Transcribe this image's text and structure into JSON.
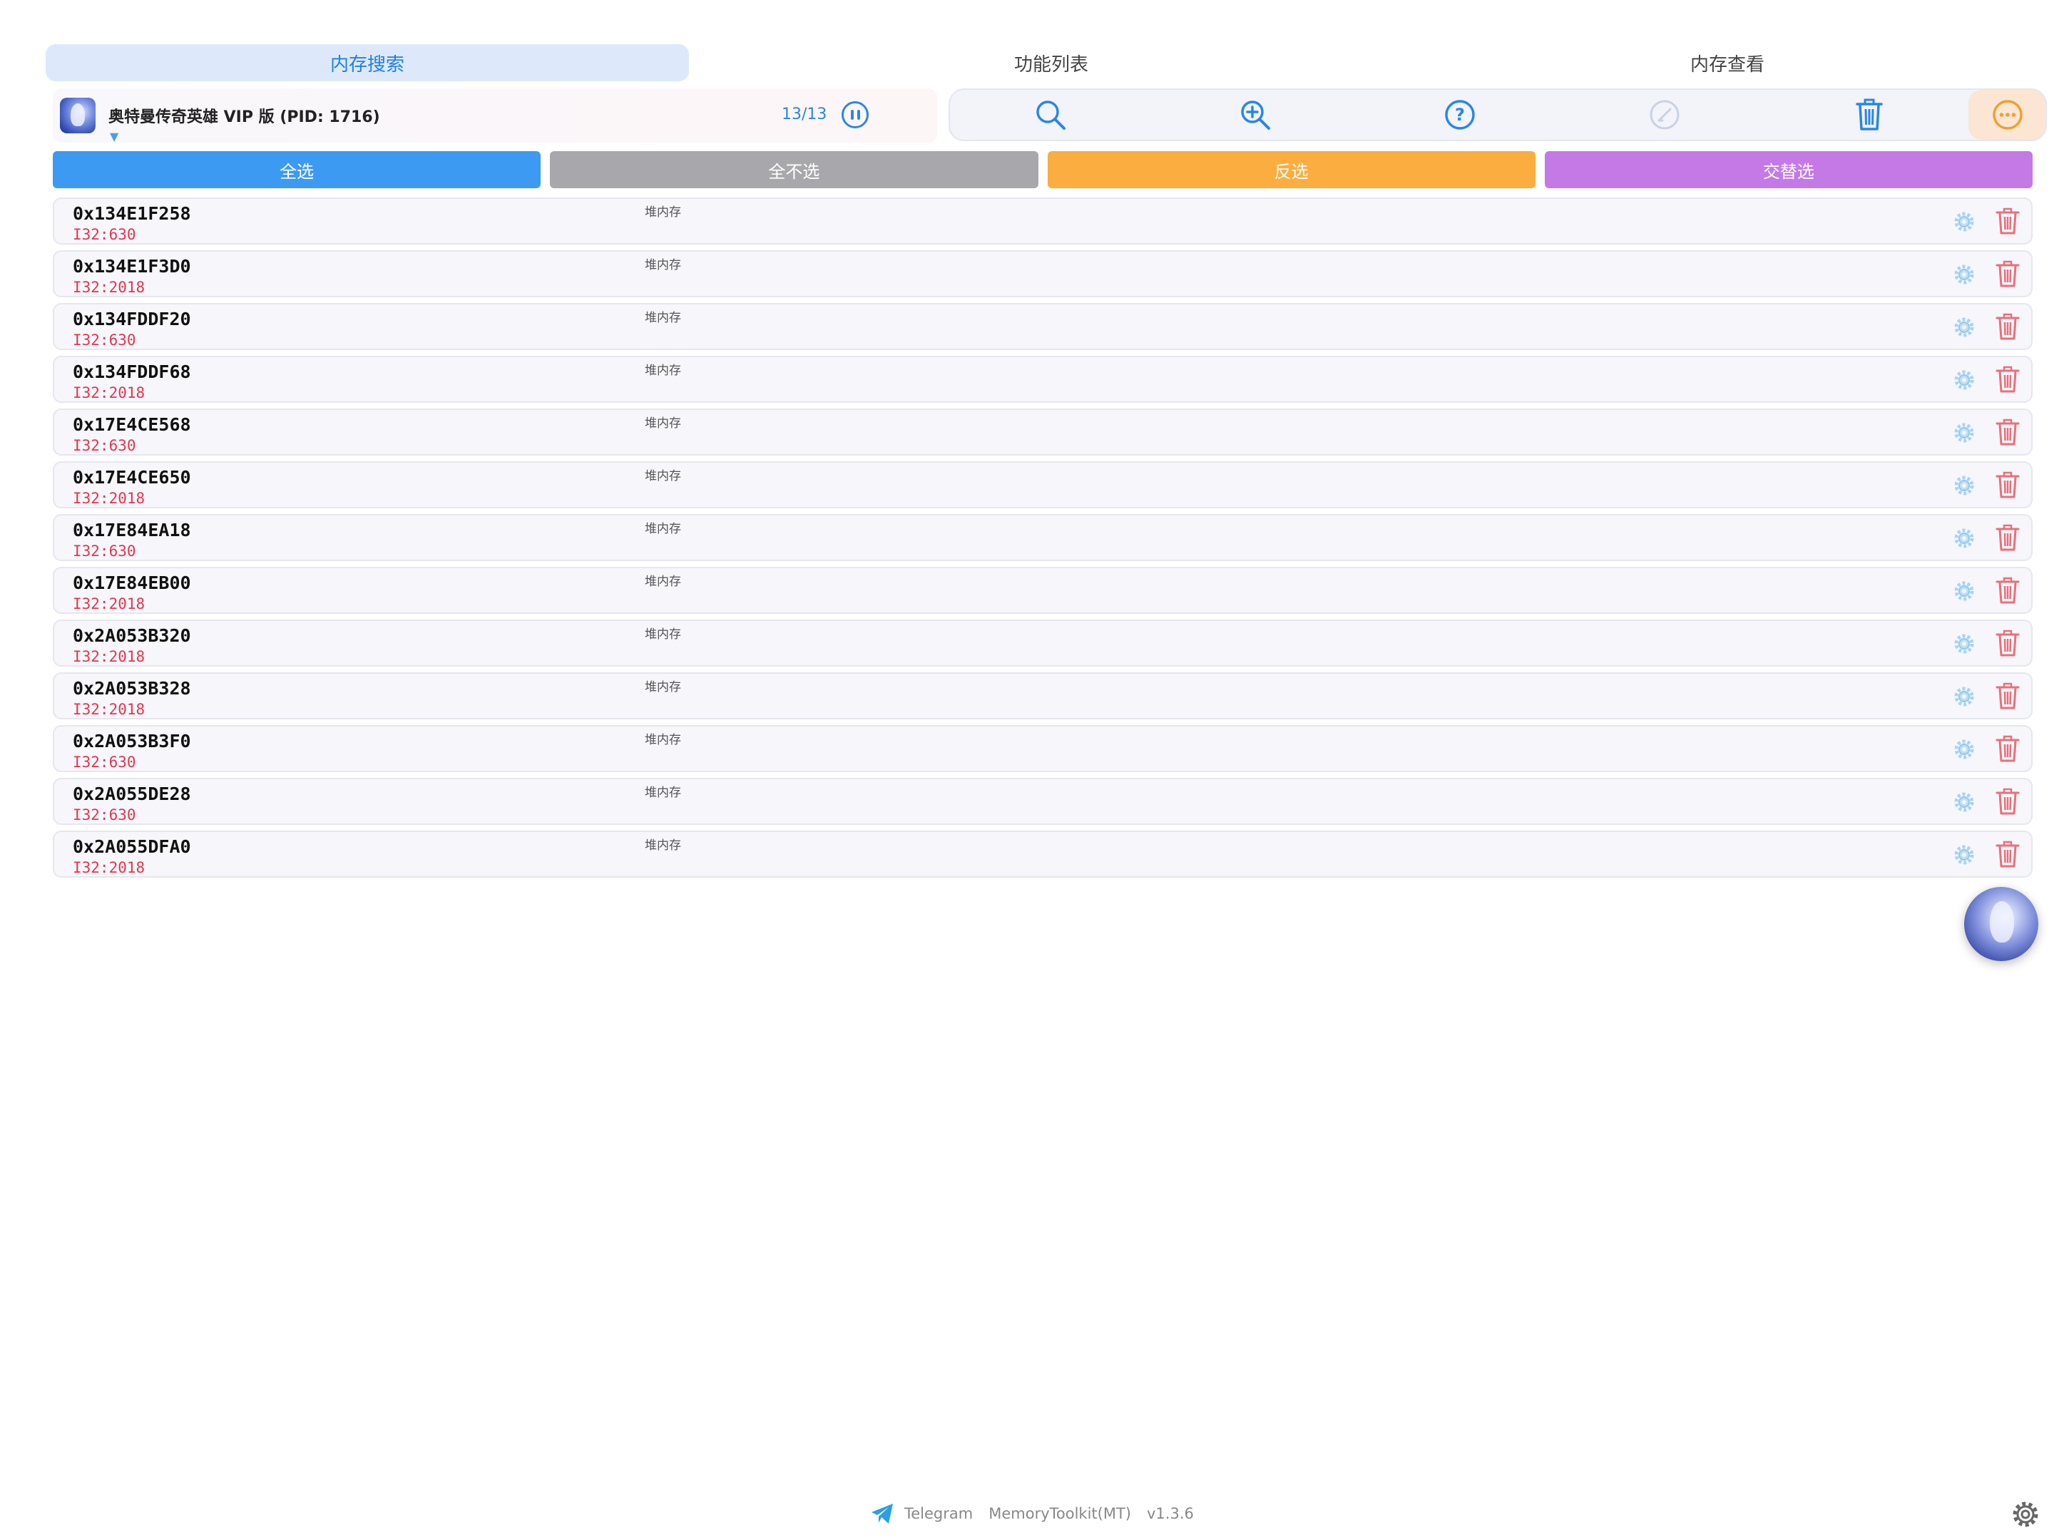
{
  "tabs": [
    {
      "label": "内存搜索",
      "active": true
    },
    {
      "label": "功能列表",
      "active": false
    },
    {
      "label": "内存查看",
      "active": false
    }
  ],
  "process": {
    "title": "奥特曼传奇英雄 VIP 版 (PID: 1716)",
    "count": "13/13",
    "caret": "▼"
  },
  "toolbar": {
    "icons": [
      "search-icon",
      "zoom-in-icon",
      "help-icon",
      "disabled-edit-icon",
      "trash-icon",
      "more-icon"
    ]
  },
  "actions": [
    {
      "label": "全选",
      "color": "#3d9af2"
    },
    {
      "label": "全不选",
      "color": "#a8a7ab"
    },
    {
      "label": "反选",
      "color": "#fbad3f"
    },
    {
      "label": "交替选",
      "color": "#c47ae6"
    }
  ],
  "results": [
    {
      "address": "0x134E1F258",
      "type": "I32:630",
      "region": "堆内存"
    },
    {
      "address": "0x134E1F3D0",
      "type": "I32:2018",
      "region": "堆内存"
    },
    {
      "address": "0x134FDDF20",
      "type": "I32:630",
      "region": "堆内存"
    },
    {
      "address": "0x134FDDF68",
      "type": "I32:2018",
      "region": "堆内存"
    },
    {
      "address": "0x17E4CE568",
      "type": "I32:630",
      "region": "堆内存"
    },
    {
      "address": "0x17E4CE650",
      "type": "I32:2018",
      "region": "堆内存"
    },
    {
      "address": "0x17E84EA18",
      "type": "I32:630",
      "region": "堆内存"
    },
    {
      "address": "0x17E84EB00",
      "type": "I32:2018",
      "region": "堆内存"
    },
    {
      "address": "0x2A053B320",
      "type": "I32:2018",
      "region": "堆内存"
    },
    {
      "address": "0x2A053B328",
      "type": "I32:2018",
      "region": "堆内存"
    },
    {
      "address": "0x2A053B3F0",
      "type": "I32:630",
      "region": "堆内存"
    },
    {
      "address": "0x2A055DE28",
      "type": "I32:630",
      "region": "堆内存"
    },
    {
      "address": "0x2A055DFA0",
      "type": "I32:2018",
      "region": "堆内存"
    }
  ],
  "footer": {
    "telegram": "Telegram",
    "app": "MemoryToolkit(MT)",
    "version": "v1.3.6"
  },
  "colors": {
    "accent": "#2a86e6",
    "value_red": "#e0374e",
    "delete_red": "#e8707a",
    "more_orange": "#f0a030"
  }
}
